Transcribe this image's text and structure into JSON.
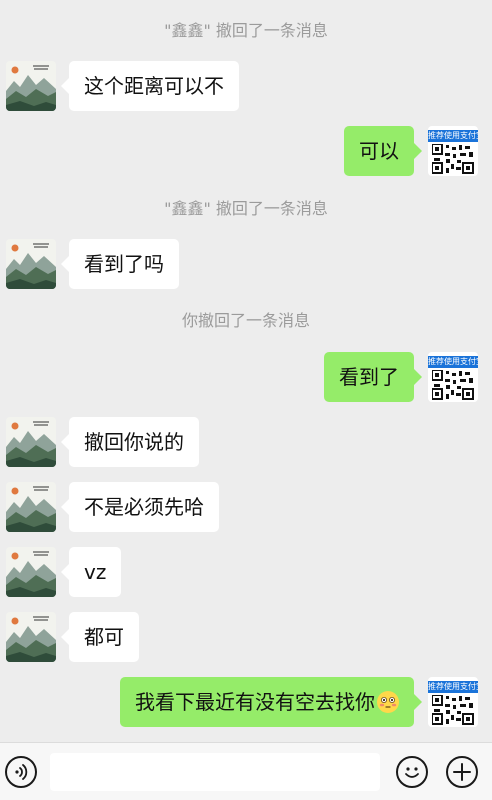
{
  "recalls": [
    {
      "name": "\"鑫鑫\"",
      "text": "撤回了一条消息"
    },
    {
      "name": "\"鑫鑫\"",
      "text": "撤回了一条消息"
    },
    {
      "name": "你",
      "text": "撤回了一条消息"
    }
  ],
  "messages": [
    {
      "from": "other",
      "text": "这个距离可以不"
    },
    {
      "from": "me",
      "text": "可以"
    },
    {
      "from": "other",
      "text": "看到了吗"
    },
    {
      "from": "me",
      "text": "看到了"
    },
    {
      "from": "other",
      "text": "撤回你说的"
    },
    {
      "from": "other",
      "text": "不是必须先哈"
    },
    {
      "from": "other",
      "text": "vz"
    },
    {
      "from": "other",
      "text": "都可"
    },
    {
      "from": "me",
      "text": "我看下最近有没有空去找你",
      "emoji": "flushed-face"
    }
  ],
  "self_avatar_caption": "推荐使用支付宝",
  "colors": {
    "background": "#ededed",
    "outgoing_bubble": "#95ec69",
    "incoming_bubble": "#ffffff",
    "system_text": "#9b9b9b",
    "qr_header": "#1a73d9"
  },
  "input_bar": {
    "voice_icon": "voice-icon",
    "emoji_icon": "emoji-icon",
    "plus_icon": "plus-icon"
  }
}
